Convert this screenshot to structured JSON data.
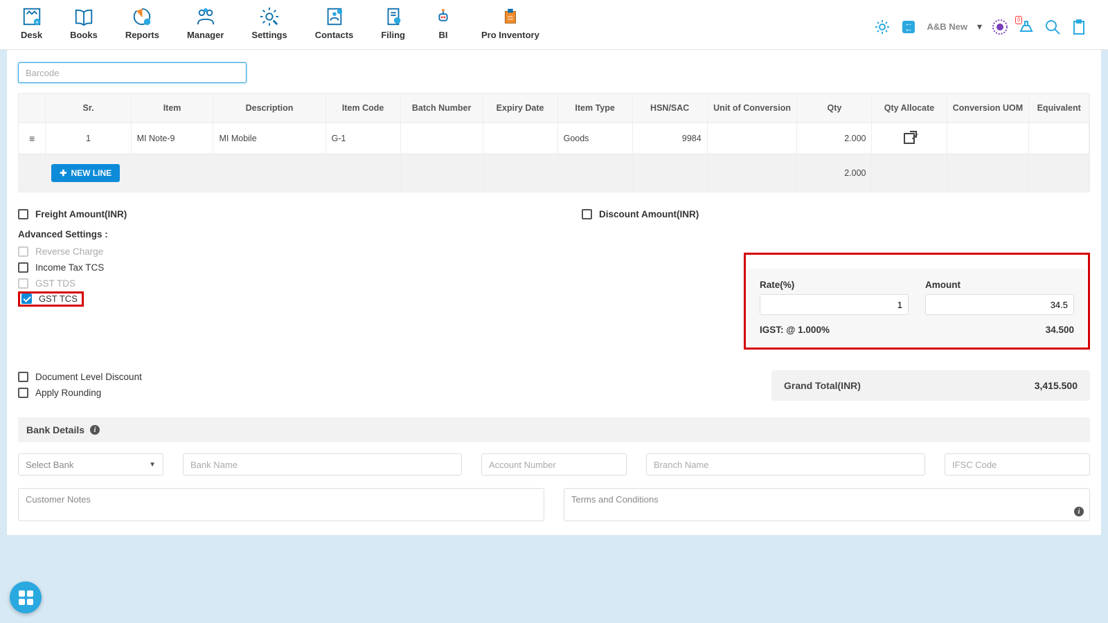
{
  "nav": {
    "items": [
      {
        "label": "Desk"
      },
      {
        "label": "Books"
      },
      {
        "label": "Reports"
      },
      {
        "label": "Manager"
      },
      {
        "label": "Settings"
      },
      {
        "label": "Contacts"
      },
      {
        "label": "Filing"
      },
      {
        "label": "BI"
      },
      {
        "label": "Pro Inventory"
      }
    ],
    "org": "A&B New",
    "notif_count": "0"
  },
  "barcode": {
    "placeholder": "Barcode"
  },
  "table": {
    "headers": [
      "",
      "Sr.",
      "Item",
      "Description",
      "Item Code",
      "Batch Number",
      "Expiry Date",
      "Item Type",
      "HSN/SAC",
      "Unit of Conversion",
      "Qty",
      "Qty Allocate",
      "Conversion UOM",
      "Equivalent"
    ],
    "rows": [
      {
        "sr": "1",
        "item": "MI Note-9",
        "desc": "MI Mobile",
        "code": "G-1",
        "batch": "",
        "expiry": "",
        "type": "Goods",
        "hsn": "9984",
        "uoc": "",
        "qty": "2.000",
        "alloc_icon": true,
        "cuom": "",
        "equiv": ""
      }
    ],
    "total_qty": "2.000",
    "new_line_label": "NEW LINE"
  },
  "amounts": {
    "freight_label": "Freight Amount(INR)",
    "discount_label": "Discount Amount(INR)"
  },
  "advanced": {
    "title": "Advanced Settings :",
    "reverse": "Reverse Charge",
    "incometcs": "Income Tax TCS",
    "gsttds": "GST TDS",
    "gsttcs": "GST TCS",
    "doclvl": "Document Level Discount",
    "rounding": "Apply Rounding"
  },
  "tax": {
    "rate_label": "Rate(%)",
    "rate_value": "1",
    "amount_label": "Amount",
    "amount_value": "34.5",
    "igst_label": "IGST: @ 1.000%",
    "igst_amount": "34.500"
  },
  "grand": {
    "label": "Grand Total(INR)",
    "value": "3,415.500"
  },
  "bank": {
    "title": "Bank Details",
    "select": "Select Bank",
    "bank_name_ph": "Bank Name",
    "acct_ph": "Account Number",
    "branch_ph": "Branch Name",
    "ifsc_ph": "IFSC Code"
  },
  "notes": {
    "customer_ph": "Customer Notes",
    "terms_ph": "Terms and Conditions"
  }
}
